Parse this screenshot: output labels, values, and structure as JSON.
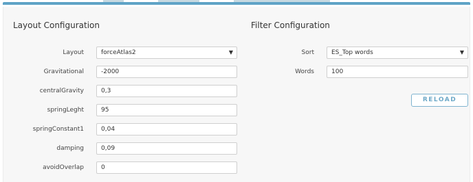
{
  "layout": {
    "title": "Layout Configuration",
    "fields": [
      {
        "label": "Layout",
        "value": "forceAtlas2",
        "type": "select"
      },
      {
        "label": "Gravitational",
        "value": "-2000"
      },
      {
        "label": "centralGravity",
        "value": "0,3"
      },
      {
        "label": "springLeght",
        "value": "95"
      },
      {
        "label": "springConstant1",
        "value": "0,04"
      },
      {
        "label": "damping",
        "value": "0,09"
      },
      {
        "label": "avoidOverlap",
        "value": "0"
      }
    ]
  },
  "filter": {
    "title": "Filter Configuration",
    "fields": [
      {
        "label": "Sort",
        "value": "ES_Top words",
        "type": "select"
      },
      {
        "label": "Words",
        "value": "100"
      }
    ],
    "reload_label": "RELOAD"
  },
  "icons": {
    "dropdown": "chevron-down-icon"
  },
  "colors": {
    "accent": "#5fa3c6",
    "button_text": "#6ea9c8"
  }
}
